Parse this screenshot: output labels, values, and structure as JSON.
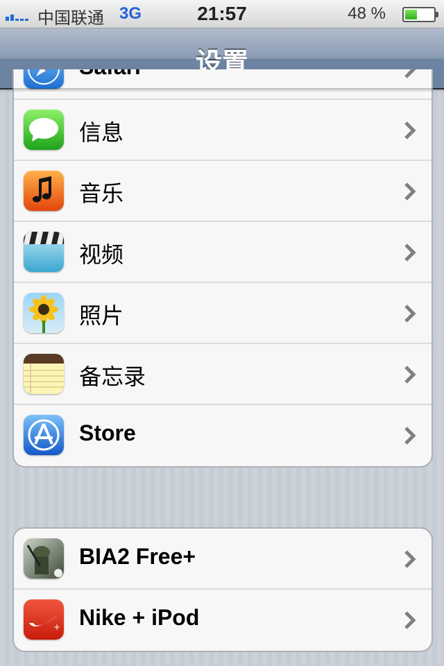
{
  "status_bar": {
    "carrier": "中国联通",
    "network": "3G",
    "time": "21:57",
    "battery_percent": "48 %",
    "battery_level": 0.48
  },
  "nav": {
    "title": "设置"
  },
  "group1": {
    "items": [
      {
        "label": "Safari",
        "icon": "safari-icon"
      },
      {
        "label": "信息",
        "icon": "messages-icon"
      },
      {
        "label": "音乐",
        "icon": "music-icon"
      },
      {
        "label": "视频",
        "icon": "videos-icon"
      },
      {
        "label": "照片",
        "icon": "photos-icon"
      },
      {
        "label": "备忘录",
        "icon": "notes-icon"
      },
      {
        "label": "Store",
        "icon": "app-store-icon"
      }
    ]
  },
  "group2": {
    "items": [
      {
        "label": "BIA2 Free+",
        "icon": "bia2-game-icon"
      },
      {
        "label": "Nike + iPod",
        "icon": "nike-ipod-icon"
      }
    ]
  }
}
